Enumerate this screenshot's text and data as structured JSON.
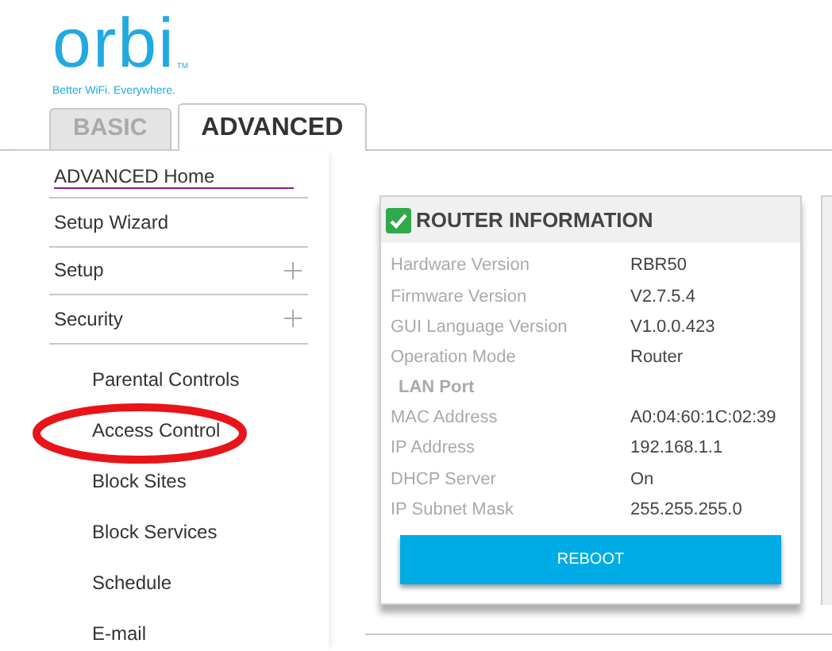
{
  "logo": {
    "wordmark": "orbi",
    "trademark": "TM",
    "tagline": "Better WiFi. Everywhere."
  },
  "tabs": [
    {
      "label": "BASIC",
      "selected": false
    },
    {
      "label": "ADVANCED",
      "selected": true
    }
  ],
  "sidebar": {
    "items": [
      {
        "kind": "home",
        "label": "ADVANCED Home"
      },
      {
        "kind": "item",
        "label": "Setup Wizard",
        "expandable": false
      },
      {
        "kind": "item",
        "label": "Setup",
        "expandable": true
      },
      {
        "kind": "item",
        "label": "Security",
        "expandable": true
      },
      {
        "kind": "subitem",
        "label": "Parental Controls"
      },
      {
        "kind": "subitem",
        "label": "Access Control"
      },
      {
        "kind": "subitem",
        "label": "Block Sites"
      },
      {
        "kind": "subitem",
        "label": "Block Services"
      },
      {
        "kind": "subitem",
        "label": "Schedule"
      },
      {
        "kind": "subitem",
        "label": "E-mail"
      }
    ]
  },
  "router_information": {
    "title": "ROUTER INFORMATION",
    "rows": [
      {
        "kind": "field",
        "label": "Hardware Version",
        "value": "RBR50"
      },
      {
        "kind": "field",
        "label": "Firmware Version",
        "value": "V2.7.5.4"
      },
      {
        "kind": "field",
        "label": "GUI Language Version",
        "value": "V1.0.0.423"
      },
      {
        "kind": "field",
        "label": "Operation Mode",
        "value": "Router"
      },
      {
        "kind": "section",
        "label": "LAN Port"
      },
      {
        "kind": "field",
        "label": "MAC Address",
        "value": "A0:04:60:1C:02:39"
      },
      {
        "kind": "field",
        "label": "IP Address",
        "value": "192.168.1.1"
      },
      {
        "kind": "field",
        "label": "DHCP Server",
        "value": "On"
      },
      {
        "kind": "field",
        "label": "IP Subnet Mask",
        "value": "255.255.255.0"
      }
    ],
    "button": "REBOOT"
  }
}
